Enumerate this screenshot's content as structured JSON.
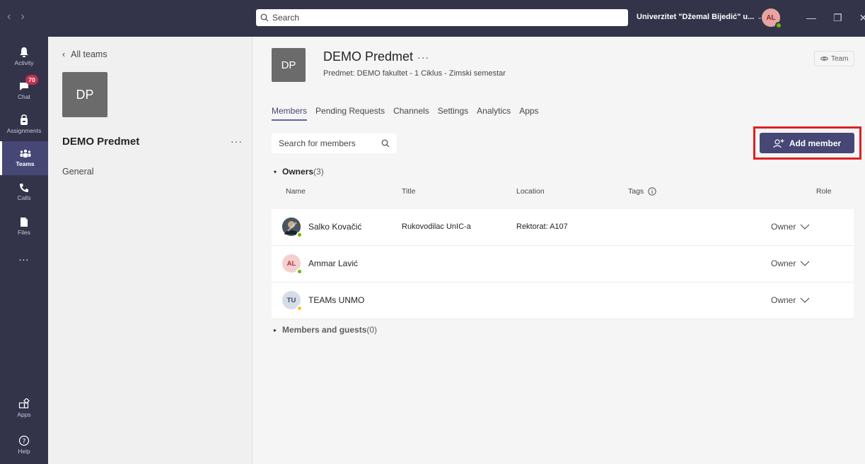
{
  "titlebar": {
    "back": "‹",
    "forward": "›",
    "search_placeholder": "Search",
    "org_name": "Univerzitet \"Džemal Bijedić\" u...",
    "org_chevron": "⌄",
    "avatar_initials": "AL",
    "minimize": "—",
    "maximize": "❐",
    "close": "✕"
  },
  "rail": {
    "items": [
      {
        "label": "Activity",
        "icon": "bell-icon"
      },
      {
        "label": "Chat",
        "icon": "chat-icon",
        "badge": "70"
      },
      {
        "label": "Assignments",
        "icon": "bag-icon"
      },
      {
        "label": "Teams",
        "icon": "teams-icon",
        "active": true
      },
      {
        "label": "Calls",
        "icon": "phone-icon"
      },
      {
        "label": "Files",
        "icon": "file-icon"
      },
      {
        "label": "...",
        "icon": "more-icon"
      },
      {
        "label": "Apps",
        "icon": "apps-icon"
      },
      {
        "label": "Help",
        "icon": "help-icon"
      }
    ]
  },
  "panel": {
    "back_label": "All teams",
    "tile_initials": "DP",
    "team_name": "DEMO Predmet",
    "more": "···",
    "channel": "General"
  },
  "main": {
    "tile_initials": "DP",
    "title": "DEMO Predmet",
    "title_more": "···",
    "subtitle": "Predmet: DEMO fakultet - 1 Ciklus - Zimski semestar",
    "team_pill": "Team",
    "tabs": [
      "Members",
      "Pending Requests",
      "Channels",
      "Settings",
      "Analytics",
      "Apps"
    ],
    "search_placeholder": "Search for members",
    "add_member": "Add member",
    "owners_label": "Owners",
    "owners_count": "(3)",
    "columns": {
      "name": "Name",
      "title": "Title",
      "location": "Location",
      "tags": "Tags",
      "role": "Role"
    },
    "owners": [
      {
        "name": "Salko Kovačić",
        "title": "Rukovodilac UnIC-a",
        "location": "Rektorat: A107",
        "role": "Owner",
        "initials": "",
        "status": "available"
      },
      {
        "name": "Ammar Lavić",
        "title": "",
        "location": "",
        "role": "Owner",
        "initials": "AL",
        "status": "available"
      },
      {
        "name": "TEAMs UNMO",
        "title": "",
        "location": "",
        "role": "Owner",
        "initials": "TU",
        "status": "away"
      }
    ],
    "members_label": "Members and guests",
    "members_count": "(0)"
  },
  "colors": {
    "rail_bg": "#33344a",
    "accent": "#464775",
    "highlight_box": "#e02020",
    "available": "#6bb700",
    "away": "#f8c42c"
  }
}
